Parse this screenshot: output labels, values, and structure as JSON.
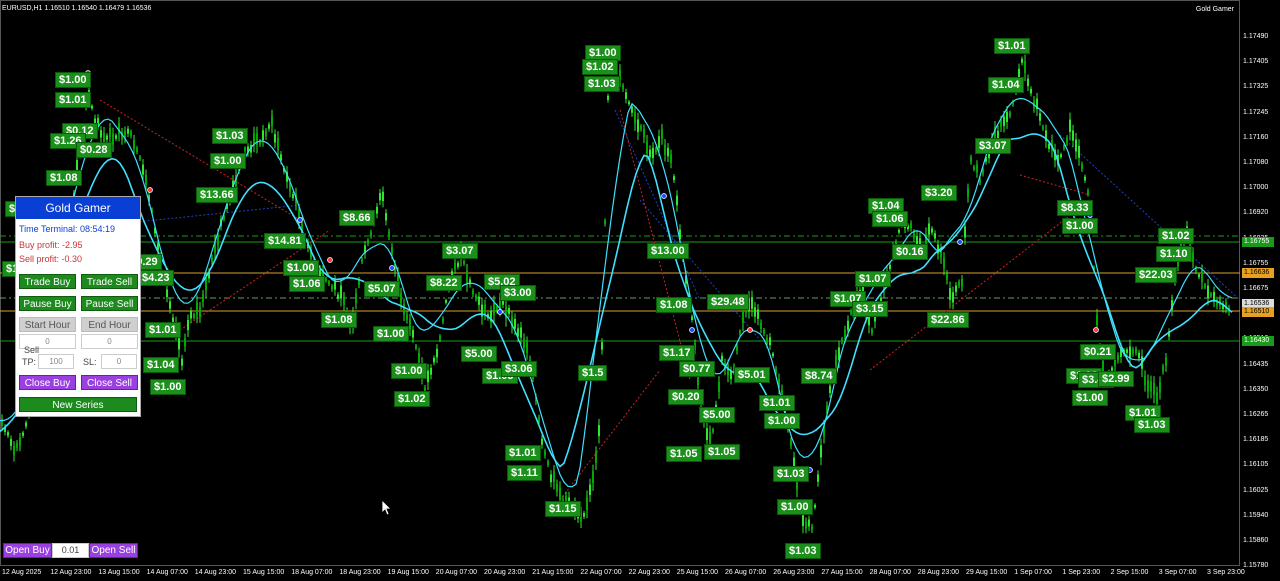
{
  "header": {
    "symbol": "EURUSD,H1  1.16510 1.16540 1.16479 1.16536",
    "ea_name": "Gold Gamer"
  },
  "colors": {
    "candle": "#2ee82e",
    "ma": "#40e0ff",
    "buy_dot": "#2050ff",
    "sell_dot": "#ff3a3a",
    "green_line": "#1a9a1a",
    "orange_line": "#d8a030",
    "profit_bg": "#1a8f1a",
    "panel_header": "#0a3fd6"
  },
  "price_axis": [
    "1.17490",
    "1.17405",
    "1.17325",
    "1.17245",
    "1.17160",
    "1.17080",
    "1.17000",
    "1.16920",
    "1.16835",
    "1.16755",
    "1.16675",
    "1.16595",
    "1.16510",
    "1.16435",
    "1.16350",
    "1.16265",
    "1.16185",
    "1.16105",
    "1.16025",
    "1.15940",
    "1.15860",
    "1.15780"
  ],
  "price_tags": {
    "line1": "1.16755",
    "line2": "1.16636",
    "line3": "1.16536",
    "line4": "1.16510",
    "line5": "1.16430"
  },
  "date_axis": [
    "12 Aug 2025",
    "12 Aug 23:00",
    "13 Aug 15:00",
    "14 Aug 07:00",
    "14 Aug 23:00",
    "15 Aug 15:00",
    "18 Aug 07:00",
    "18 Aug 23:00",
    "19 Aug 15:00",
    "20 Aug 07:00",
    "20 Aug 23:00",
    "21 Aug 15:00",
    "22 Aug 07:00",
    "22 Aug 23:00",
    "25 Aug 15:00",
    "26 Aug 07:00",
    "26 Aug 23:00",
    "27 Aug 15:00",
    "28 Aug 07:00",
    "28 Aug 23:00",
    "29 Aug 15:00",
    "1 Sep 07:00",
    "1 Sep 23:00",
    "2 Sep 15:00",
    "3 Sep 07:00",
    "3 Sep 23:00"
  ],
  "profit_labels": [
    "$1.00",
    "$1.01",
    "$0.12",
    "$1.26",
    "$0.28",
    "$1.08",
    "$1.08",
    "$1.03",
    "$19.29",
    "$4.23",
    "$1.01",
    "$1.04",
    "$1.00",
    "$1.03",
    "$1.00",
    "$13.66",
    "$14.81",
    "$1.00",
    "$1.06",
    "$8.66",
    "$5.07",
    "$1.08",
    "$1.00",
    "$1.00",
    "$1.02",
    "$3.07",
    "$8.22",
    "$5.02",
    "$3.00",
    "$5.00",
    "$1.05",
    "$3.06",
    "$1.01",
    "$1.11",
    "$1.15",
    "$1.00",
    "$1.02",
    "$1.03",
    "$13.00",
    "$1.08",
    "$1.17",
    "$1.5",
    "$0.77",
    "$0.20",
    "$5.00",
    "$1.05",
    "$1.05",
    "$29.48",
    "$5.01",
    "$8.74",
    "$1.01",
    "$1.00",
    "$1.03",
    "$1.00",
    "$1.03",
    "$1.04",
    "$1.06",
    "$1.07",
    "$1.07",
    "$3.15",
    "$3.20",
    "$0.16",
    "$22.86",
    "$1.01",
    "$1.04",
    "$3.07",
    "$8.33",
    "$1.00",
    "$1.02",
    "$1.10",
    "$22.03",
    "$0.21",
    "$1.01",
    "$3.48",
    "$2.99",
    "$1.00",
    "$1.01",
    "$1.03"
  ],
  "panel": {
    "title": "Gold Gamer",
    "time_terminal": "Time Terminal: 08:54:19",
    "buy_profit": "Buy profit: -2.95",
    "sell_profit": "Sell profit: -0.30",
    "trade_buy": "Trade Buy",
    "trade_sell": "Trade Sell",
    "pause_buy": "Pause Buy",
    "pause_sell": "Pause Sell",
    "start_hour": "Start Hour",
    "end_hour": "End Hour",
    "start_value": "0",
    "end_value": "0",
    "sell_label": "Sell",
    "tp_label": "TP:",
    "tp_value": "100",
    "sl_label": "SL:",
    "sl_value": "0",
    "close_buy": "Close Buy",
    "close_sell": "Close Sell",
    "new_series": "New Series"
  },
  "bottom_bar": {
    "open_buy": "Open Buy",
    "lot_value": "0.01",
    "open_sell": "Open Sell"
  }
}
